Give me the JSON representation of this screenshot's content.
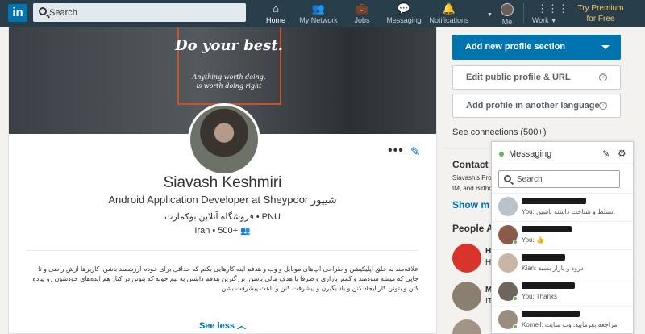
{
  "nav": {
    "logo": "in",
    "search_placeholder": "Search",
    "items": [
      {
        "label": "Home",
        "icon": "home-icon",
        "glyph": "⌂"
      },
      {
        "label": "My Network",
        "icon": "network-icon",
        "glyph": "👥"
      },
      {
        "label": "Jobs",
        "icon": "jobs-icon",
        "glyph": "💼"
      },
      {
        "label": "Messaging",
        "icon": "messaging-icon",
        "glyph": "💬"
      },
      {
        "label": "Notifications",
        "icon": "bell-icon",
        "glyph": "🔔"
      }
    ],
    "me_label": "Me",
    "work_label": "Work",
    "premium_line1": "Try Premium",
    "premium_line2": "for Free"
  },
  "profile": {
    "banner_title": "Do your best.",
    "banner_sub_line1": "Anything worth doing,",
    "banner_sub_line2": "is worth doing right",
    "name": "Siavash Keshmiri",
    "headline": "Android Application Developer at Sheypoor شیپور",
    "company": "فروشگاه آنلاین بوکمارت • PNU",
    "location": "Iran • 500+",
    "summary": "علاقه‌مند به خلق اپلیکیشن و طراحی اپ‌های موبایل و وب و هدفم اینه کارهایی بکنم که حداقل برای خودم ارزشمند باشن. کاربرها ازش راضی و تا جایی که میشه سودمند و کمتر بازاری و صرفا با هدف مالی باشن. بزرگترین هدفم داشتن یه تیم خوبه که بتونن در کنار هم ایده‌های خودشون رو پیاده کنن و بتونن کار ایجاد کنن و باد بگیرن و پیشرفت کنن و باعث پیشرفت بشن",
    "see_less": "See less"
  },
  "rail": {
    "add_section": "Add new profile section",
    "edit_url": "Edit public profile & URL",
    "add_language": "Add profile in another language",
    "connections": "See connections (500+)",
    "contact": "Contact ar",
    "contact_l1": "Siavash's Prof",
    "contact_l2": "IM, and Birthd",
    "show_more": "Show m",
    "people_also": "People Als",
    "pa1_h": "H",
    "pa1_h2": "H",
    "pa2_h": "M",
    "pa2_h2": "IT"
  },
  "messaging": {
    "title": "Messaging",
    "search_placeholder": "Search",
    "conversations": [
      {
        "preview": "You: تسلط و شناخت داشته باشین.",
        "date": ""
      },
      {
        "preview": "You: 👍",
        "date": ""
      },
      {
        "preview": "Kian: درود و بازار بسید",
        "date": ""
      },
      {
        "preview": "You: Thanks",
        "date": ""
      },
      {
        "preview": "Komeil: مراجعه بفرمایید. وب سایت",
        "date": ""
      }
    ]
  },
  "colors": {
    "nav_bg": "#283e4a",
    "brand_blue": "#0073b1",
    "premium_gold": "#f5c75d",
    "online_green": "#5cb85c"
  }
}
